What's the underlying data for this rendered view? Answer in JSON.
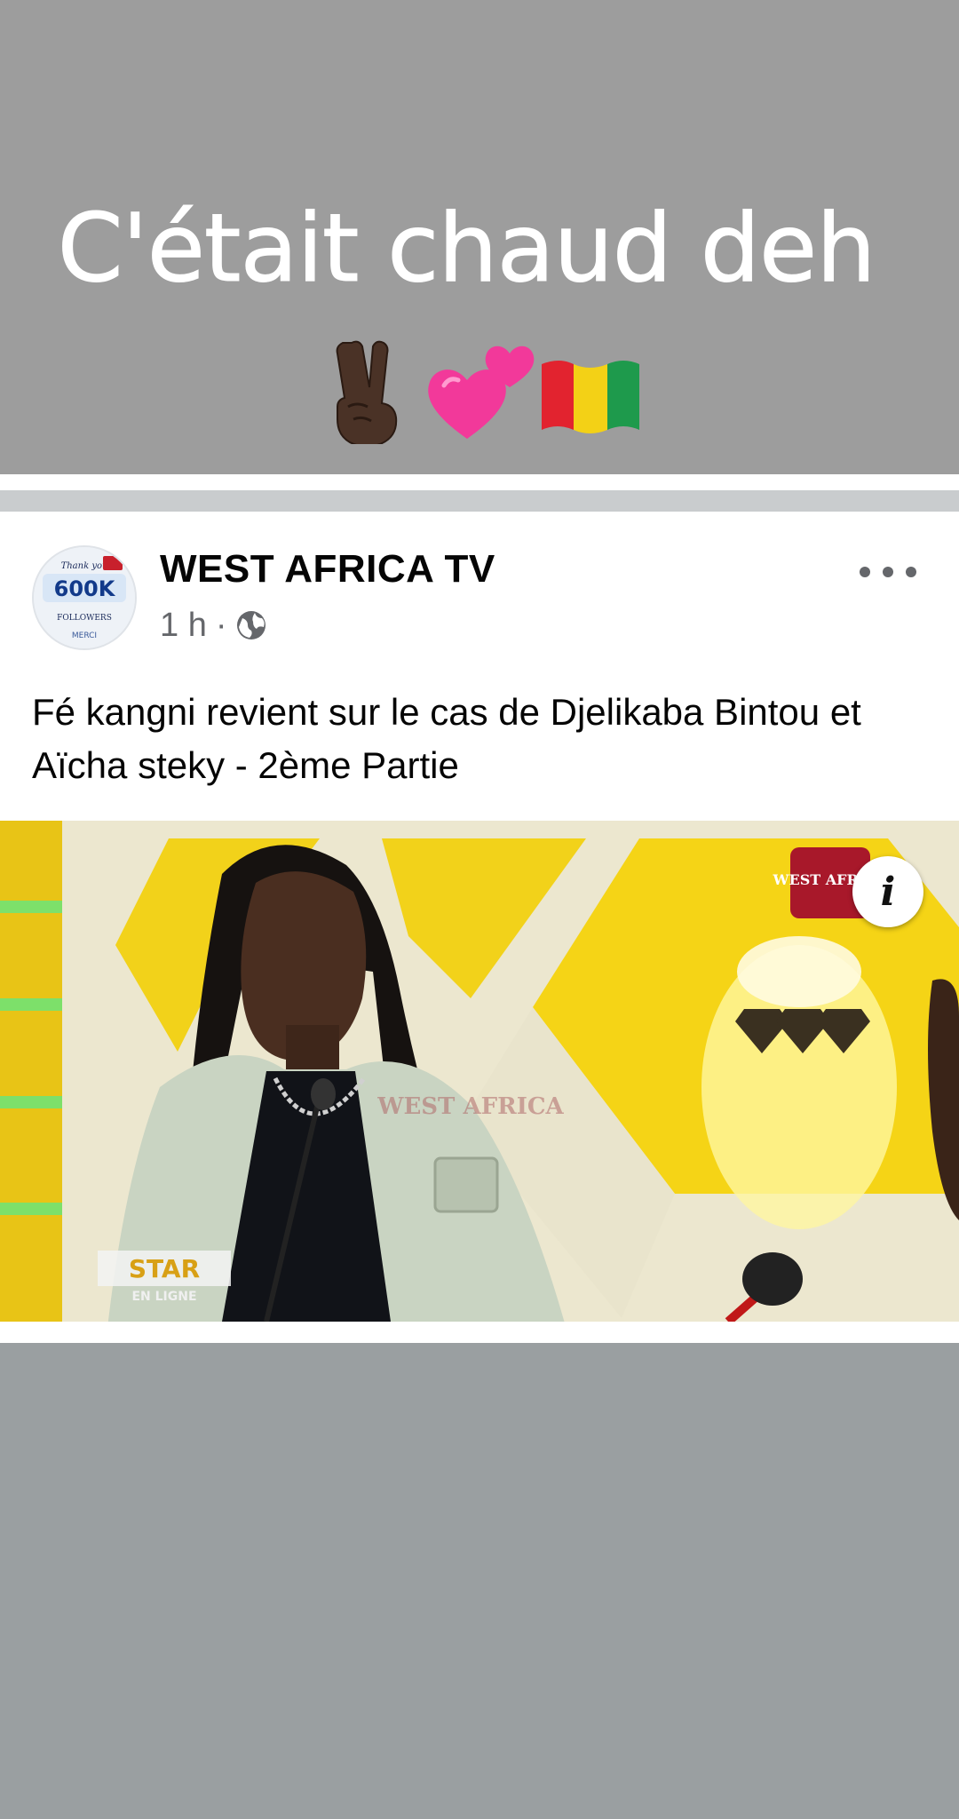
{
  "story": {
    "caption": "C'était chaud deh",
    "emojis": [
      "victory-hand-icon",
      "two-hearts-icon",
      "guinea-flag-icon"
    ]
  },
  "post": {
    "page_name": "WEST AFRICA TV",
    "time": "1 h",
    "separator": "·",
    "audience_icon": "globe-icon",
    "text": "Fé kangni revient sur le cas de Djelikaba Bintou et Aïcha steky - 2ème Partie",
    "more_icon": "more-options-icon",
    "info_icon": "info-icon",
    "info_label": "i"
  },
  "avatar": {
    "line1": "Thank you",
    "count": "600K",
    "line2": "FOLLOWERS",
    "line3": "MERCI"
  },
  "video": {
    "watermark": "WEST AFRICA",
    "logo_text": "WEST AFRICA",
    "show_title": "STAR",
    "show_subtitle": "EN LIGNE"
  },
  "colors": {
    "top_background": "#9d9d9d",
    "lower_background": "#9a9fa1",
    "card_background": "#ffffff",
    "secondary_text": "#65676b",
    "set_yellow": "#f2d21a"
  }
}
